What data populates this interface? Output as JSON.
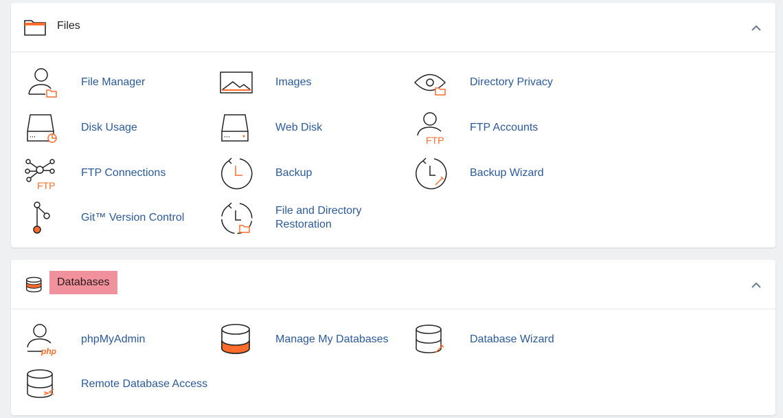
{
  "files": {
    "title": "Files",
    "items": [
      {
        "label": "File Manager",
        "icon": "file-manager-icon"
      },
      {
        "label": "Images",
        "icon": "images-icon"
      },
      {
        "label": "Directory Privacy",
        "icon": "directory-privacy-icon"
      },
      {
        "label": "Disk Usage",
        "icon": "disk-usage-icon"
      },
      {
        "label": "Web Disk",
        "icon": "web-disk-icon"
      },
      {
        "label": "FTP Accounts",
        "icon": "ftp-accounts-icon"
      },
      {
        "label": "FTP Connections",
        "icon": "ftp-connections-icon"
      },
      {
        "label": "Backup",
        "icon": "backup-icon"
      },
      {
        "label": "Backup Wizard",
        "icon": "backup-wizard-icon"
      },
      {
        "label": "Git™ Version Control",
        "icon": "git-icon"
      },
      {
        "label": "File and Directory Restoration",
        "icon": "file-restoration-icon"
      }
    ]
  },
  "databases": {
    "title": "Databases",
    "items": [
      {
        "label": "phpMyAdmin",
        "icon": "phpmyadmin-icon"
      },
      {
        "label": "Manage My Databases",
        "icon": "manage-databases-icon"
      },
      {
        "label": "Database Wizard",
        "icon": "database-wizard-icon"
      },
      {
        "label": "Remote Database Access",
        "icon": "remote-database-icon"
      }
    ]
  },
  "colors": {
    "accent": "#ff6c2c",
    "link": "#2b5a9a",
    "highlight": "#f0919b"
  },
  "icon_labels": {
    "ftp": "FTP",
    "php": "php"
  }
}
